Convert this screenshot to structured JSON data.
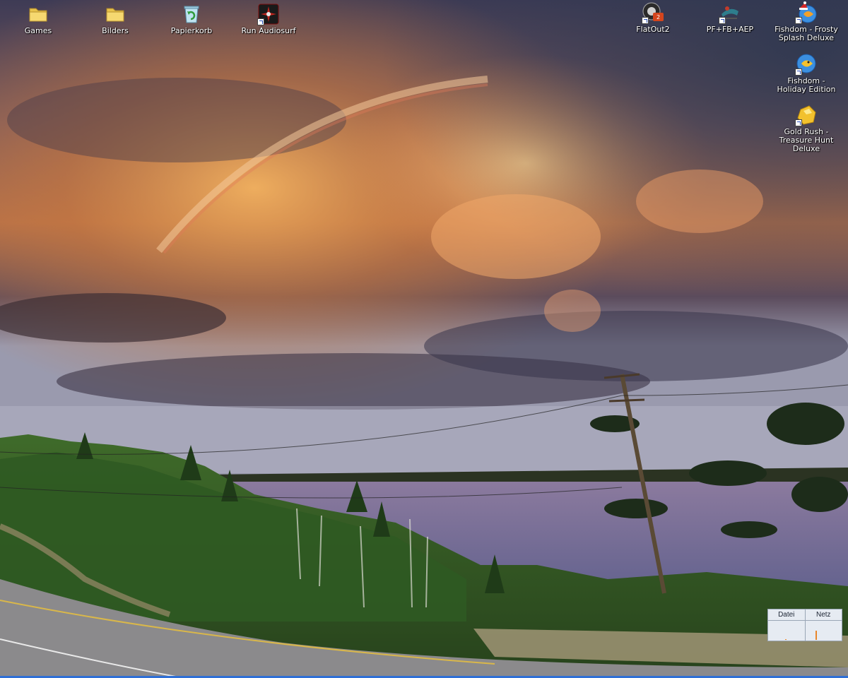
{
  "desktop": {
    "icons_left": [
      {
        "id": "games",
        "label": "Games",
        "icon": "folder-icon",
        "shortcut": false
      },
      {
        "id": "bilders",
        "label": "Bilders",
        "icon": "folder-icon",
        "shortcut": false
      },
      {
        "id": "papierkorb",
        "label": "Papierkorb",
        "icon": "recycle-bin-icon",
        "shortcut": false
      },
      {
        "id": "run-audiosurf",
        "label": "Run Audiosurf",
        "icon": "audiosurf-icon",
        "shortcut": true
      }
    ],
    "icons_right": [
      {
        "id": "flatout2",
        "label": "FlatOut2",
        "icon": "flatout-icon",
        "shortcut": true
      },
      {
        "id": "pf-fb-aep",
        "label": "PF+FB+AEP",
        "icon": "game-icon",
        "shortcut": true
      },
      {
        "id": "fishdom-frosty",
        "label": "Fishdom - Frosty Splash Deluxe",
        "icon": "fishdom-frosty-icon",
        "shortcut": true
      },
      {
        "id": "fishdom-holiday",
        "label": "Fishdom - Holiday Edition",
        "icon": "fishdom-holiday-icon",
        "shortcut": true
      },
      {
        "id": "gold-rush",
        "label": "Gold Rush - Treasure Hunt Deluxe",
        "icon": "gold-nugget-icon",
        "shortcut": true
      }
    ]
  },
  "meter_widget": {
    "columns": [
      {
        "label": "Datei",
        "level": 0.05
      },
      {
        "label": "Netz",
        "level": 0.5
      }
    ]
  },
  "colors": {
    "taskbar_edge": "#2f6fd6",
    "meter_bar": "#e8862a"
  }
}
